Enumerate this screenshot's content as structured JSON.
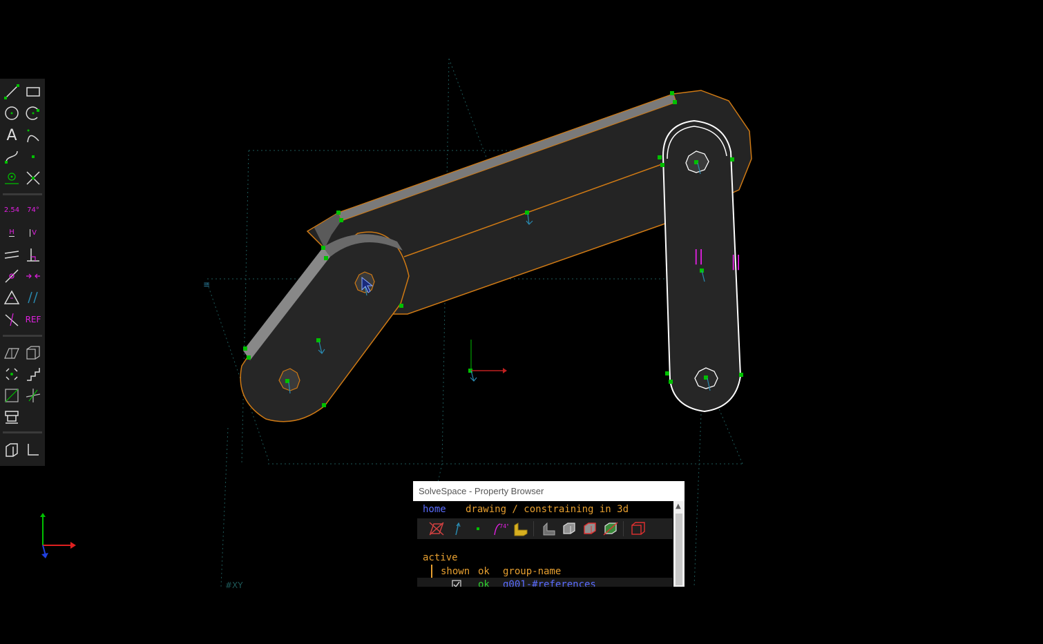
{
  "window": {
    "title": "SolveSpace - Property Browser"
  },
  "viewport": {
    "workplane_label": "#XY",
    "colors": {
      "background": "#000000",
      "solid_fill": "#2a2a2a",
      "edge": "#d07a14",
      "selected": "#ffffff",
      "point": "#00c000",
      "constraint": "#e020e0"
    }
  },
  "toolbar": {
    "tools": [
      {
        "name": "line",
        "icon": "line-icon"
      },
      {
        "name": "rectangle",
        "icon": "rectangle-icon"
      },
      {
        "name": "circle",
        "icon": "circle-icon"
      },
      {
        "name": "arc",
        "icon": "arc-icon"
      },
      {
        "name": "text",
        "icon": "text-icon",
        "label": "A"
      },
      {
        "name": "tangent-arc",
        "icon": "tangent-arc-icon"
      },
      {
        "name": "cubic-spline",
        "icon": "spline-icon"
      },
      {
        "name": "datum-point",
        "icon": "point-icon"
      },
      {
        "name": "construction",
        "icon": "construction-icon"
      },
      {
        "name": "split-curves",
        "icon": "split-icon"
      },
      {
        "name": "distance",
        "icon": "distance-icon",
        "label": "2.54"
      },
      {
        "name": "angle",
        "icon": "angle-icon",
        "label": "74°"
      },
      {
        "name": "horizontal",
        "icon": "horizontal-icon",
        "label": "H"
      },
      {
        "name": "vertical",
        "icon": "vertical-icon",
        "label": "V"
      },
      {
        "name": "parallel",
        "icon": "parallel-icon"
      },
      {
        "name": "perpendicular",
        "icon": "perpendicular-icon"
      },
      {
        "name": "point-on-line",
        "icon": "point-on-line-icon"
      },
      {
        "name": "symmetric",
        "icon": "symmetric-icon"
      },
      {
        "name": "equal",
        "icon": "equal-icon"
      },
      {
        "name": "same-orientation",
        "icon": "orientation-icon"
      },
      {
        "name": "other-supplementary",
        "icon": "other-icon"
      },
      {
        "name": "reference",
        "icon": "ref-icon",
        "label": "REF"
      },
      {
        "name": "workplane",
        "icon": "workplane-icon"
      },
      {
        "name": "extrude",
        "icon": "extrude-icon"
      },
      {
        "name": "lathe",
        "icon": "lathe-icon"
      },
      {
        "name": "step-rotate",
        "icon": "step-rotate-icon"
      },
      {
        "name": "step-translate",
        "icon": "step-translate-icon"
      },
      {
        "name": "sketch-in-3d",
        "icon": "sketch-3d-icon"
      },
      {
        "name": "link",
        "icon": "link-icon"
      },
      {
        "name": "assemble",
        "icon": "assemble-icon"
      },
      {
        "name": "new-part",
        "icon": "part-icon"
      }
    ]
  },
  "property_browser": {
    "nav": {
      "home_label": "home",
      "title": "drawing / constraining in 3d"
    },
    "icons": [
      "hide-workplanes-icon",
      "show-normals-icon",
      "show-points-icon",
      "show-constraints-icon",
      "show-faces-icon",
      "shaded-icon",
      "edges-icon",
      "outlines-icon",
      "mesh-icon",
      "hidden-lines-icon",
      "wireframe-icon"
    ],
    "section_label": "active",
    "columns": {
      "shown": "shown",
      "ok": "ok",
      "group_name": "group-name"
    },
    "groups": [
      {
        "shown": true,
        "ok": "ok",
        "name": "g001-#references"
      }
    ]
  }
}
